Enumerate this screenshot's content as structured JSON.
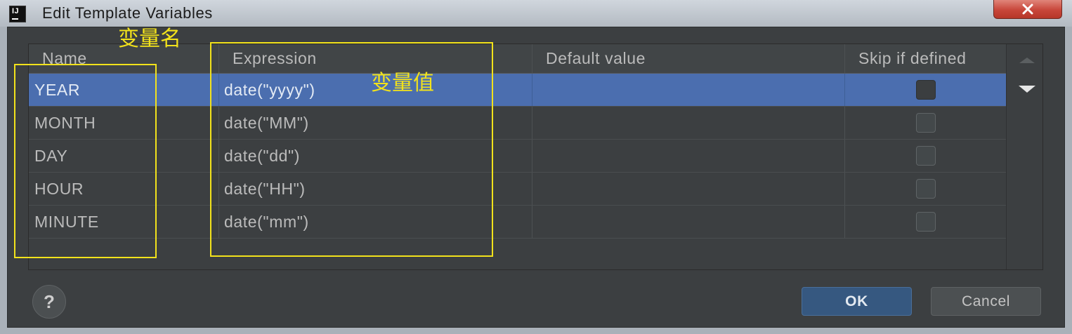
{
  "window": {
    "title": "Edit Template Variables",
    "app_icon_label": "IJ",
    "app_icon": "intellij-icon",
    "close_icon": "close-icon"
  },
  "table": {
    "columns": [
      "Name",
      "Expression",
      "Default value",
      "Skip if defined"
    ],
    "rows": [
      {
        "name": "YEAR",
        "expression": "date(\"yyyy\")",
        "default_value": "",
        "skip_if_defined": false,
        "selected": true
      },
      {
        "name": "MONTH",
        "expression": "date(\"MM\")",
        "default_value": "",
        "skip_if_defined": false,
        "selected": false
      },
      {
        "name": "DAY",
        "expression": "date(\"dd\")",
        "default_value": "",
        "skip_if_defined": false,
        "selected": false
      },
      {
        "name": "HOUR",
        "expression": "date(\"HH\")",
        "default_value": "",
        "skip_if_defined": false,
        "selected": false
      },
      {
        "name": "MINUTE",
        "expression": "date(\"mm\")",
        "default_value": "",
        "skip_if_defined": false,
        "selected": false
      }
    ]
  },
  "side_toolbar": {
    "move_up_icon": "arrow-up-icon",
    "move_up_disabled": true,
    "move_down_icon": "arrow-down-icon",
    "move_down_disabled": false
  },
  "annotations": {
    "name_label": "变量名",
    "value_label": "变量值"
  },
  "footer": {
    "help_label": "?",
    "ok_label": "OK",
    "cancel_label": "Cancel"
  },
  "colors": {
    "panel_bg": "#3c3f41",
    "selection_bg": "#4b6eaf",
    "annotation": "#f2e21b",
    "ok_bg": "#365880",
    "close_bg": "#c8463a"
  }
}
